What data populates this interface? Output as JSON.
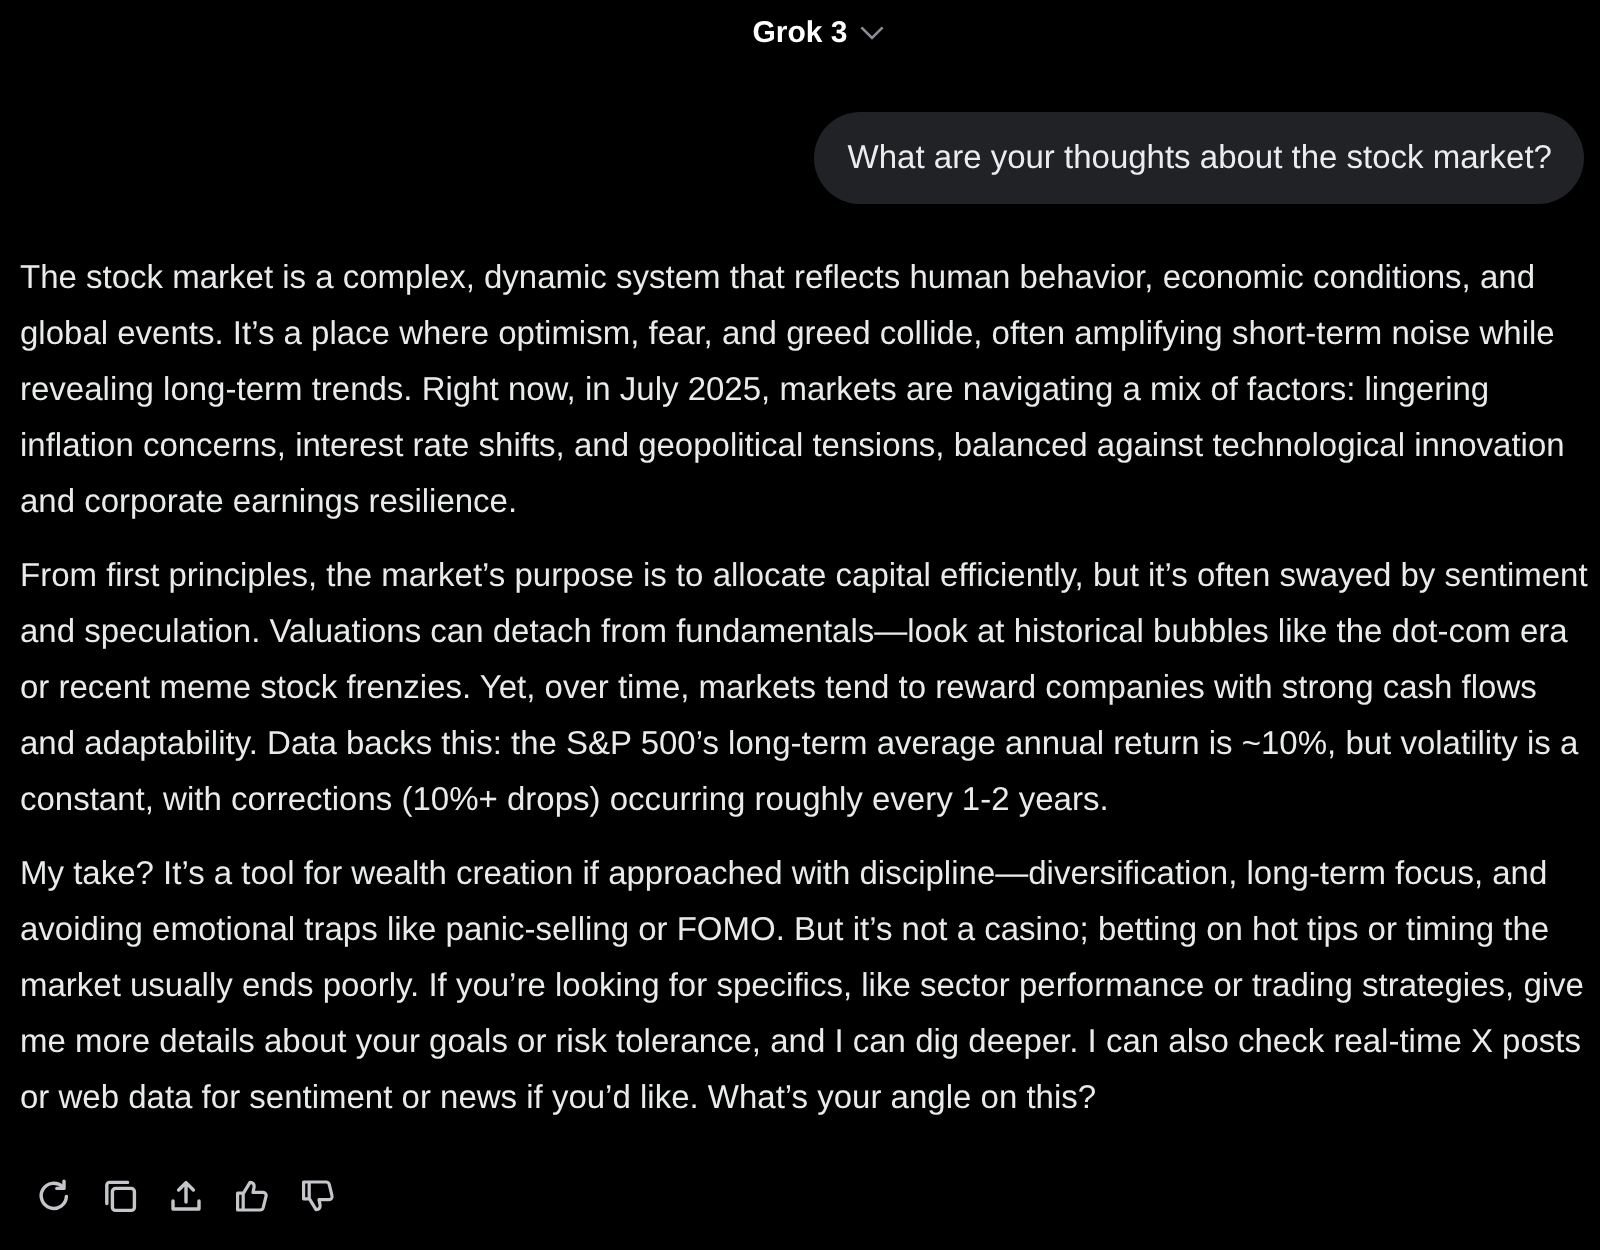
{
  "header": {
    "model": "Grok 3"
  },
  "user_message": {
    "text": "What are your thoughts about the stock market?"
  },
  "response": {
    "paragraphs": [
      "The stock market is a complex, dynamic system that reflects human behavior, economic conditions, and global events. It’s a place where optimism, fear, and greed collide, often amplifying short-term noise while revealing long-term trends. Right now, in July 2025, markets are navigating a mix of factors: lingering inflation concerns, interest rate shifts, and geopolitical tensions, balanced against technological innovation and corporate earnings resilience.",
      "From first principles, the market’s purpose is to allocate capital efficiently, but it’s often swayed by sentiment and speculation. Valuations can detach from fundamentals—look at historical bubbles like the dot-com era or recent meme stock frenzies. Yet, over time, markets tend to reward companies with strong cash flows and adaptability. Data backs this: the S&P 500’s long-term average annual return is ~10%, but volatility is a constant, with corrections (10%+ drops) occurring roughly every 1-2 years.",
      "My take? It’s a tool for wealth creation if approached with discipline—diversification, long-term focus, and avoiding emotional traps like panic-selling or FOMO. But it’s not a casino; betting on hot tips or timing the market usually ends poorly. If you’re looking for specifics, like sector performance or trading strategies, give me more details about your goals or risk tolerance, and I can dig deeper. I can also check real-time X posts or web data for sentiment or news if you’d like. What’s your angle on this?"
    ]
  },
  "actions": [
    {
      "kind": "regenerate"
    },
    {
      "kind": "copy"
    },
    {
      "kind": "share"
    },
    {
      "kind": "like"
    },
    {
      "kind": "dislike"
    }
  ]
}
